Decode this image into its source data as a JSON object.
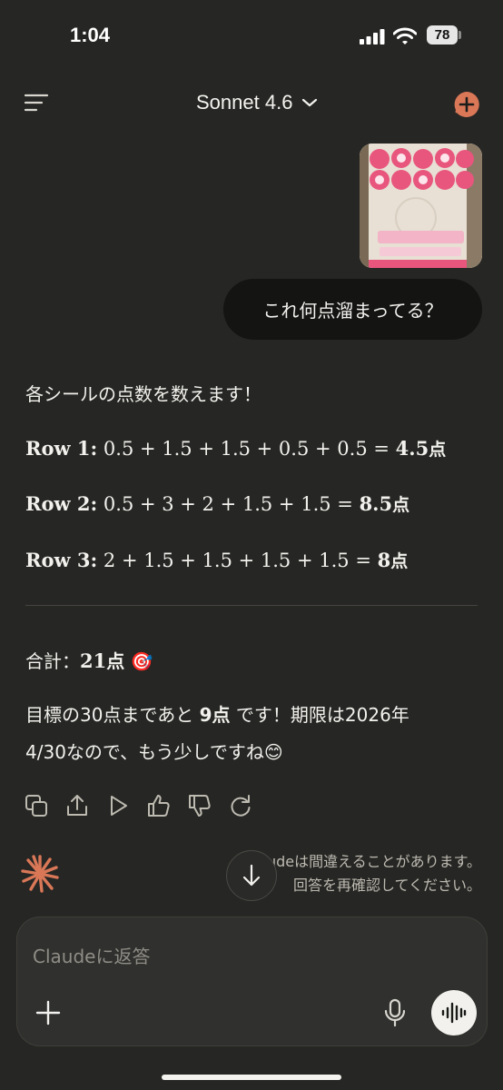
{
  "status_bar": {
    "time": "1:04",
    "battery": "78"
  },
  "header": {
    "model_name": "Sonnet 4.6"
  },
  "user_message": {
    "text": "これ何点溜まってる？"
  },
  "assistant": {
    "intro": "各シールの点数を数えます！",
    "rows": [
      {
        "label": "Row 1:",
        "expression": "0.5 + 1.5 + 1.5 + 0.5 + 0.5 =",
        "result": "4.5",
        "unit": "点"
      },
      {
        "label": "Row 2:",
        "expression": "0.5 + 3 + 2 + 1.5 + 1.5 =",
        "result": "8.5",
        "unit": "点"
      },
      {
        "label": "Row 3:",
        "expression": "2 + 1.5 + 1.5 + 1.5 + 1.5 =",
        "result": "8",
        "unit": "点"
      }
    ],
    "total_label": "合計：",
    "total_value": "21",
    "total_unit": "点",
    "total_emoji": "🎯",
    "para_line1_pre": "目標の30点まであと",
    "para_line1_bold": "9点",
    "para_line1_post": "です！期限は2026年",
    "para_line2": "4/30なので、もう少しですね😊"
  },
  "actions": [
    "copy-icon",
    "share-icon",
    "play-icon",
    "thumbs-up-icon",
    "thumbs-down-icon",
    "retry-icon"
  ],
  "disclaimer": {
    "line1": "Claudeは間違えることがあります。",
    "line2": "回答を再確認してください。"
  },
  "composer": {
    "placeholder": "Claudeに返答"
  },
  "colors": {
    "background": "#262624",
    "accent": "#d97757",
    "bubble": "#141413"
  }
}
